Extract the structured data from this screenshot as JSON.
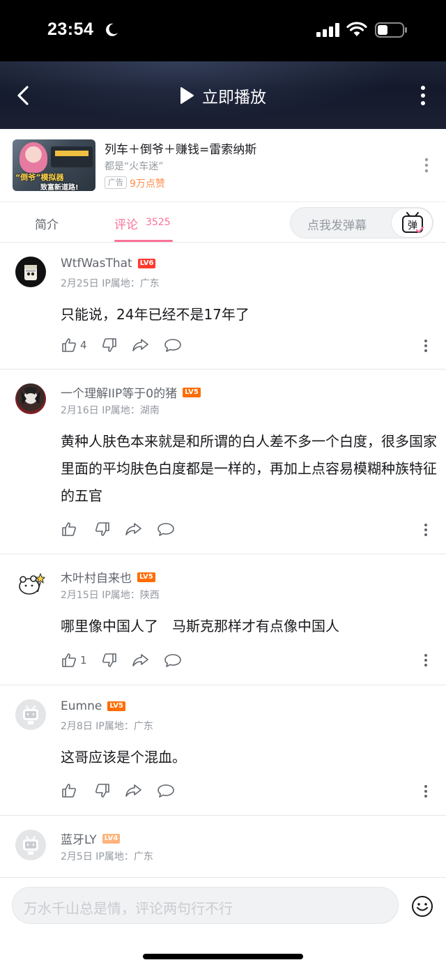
{
  "status_bar": {
    "time": "23:54"
  },
  "video_header": {
    "play_label": "立即播放"
  },
  "ad": {
    "title": "列车＋倒爷＋赚钱=雷索纳斯",
    "subtitle": "都是“火车迷”",
    "tag": "广告",
    "likes": "9万点赞",
    "thumb_text_1": "“倒爷”模拟器",
    "thumb_text_2": "致富新道路!"
  },
  "tabs": {
    "intro": "简介",
    "comments": "评论",
    "comment_count": "3525",
    "danmaku_placeholder": "点我发弹幕",
    "danmaku_icon_char": "弹"
  },
  "comments": [
    {
      "user": "WtfWasThat",
      "level": "LV6",
      "date": "2月25日",
      "ip": "IP属地：广东",
      "text": "只能说，24年已经不是17年了",
      "likes": "4"
    },
    {
      "user": "一个理解IIP等于0的猪",
      "level": "LV5",
      "date": "2月16日",
      "ip": "IP属地：湖南",
      "text": "黄种人肤色本来就是和所谓的白人差不多一个白度，很多国家里面的平均肤色白度都是一样的，再加上点容易模糊种族特征的五官",
      "likes": ""
    },
    {
      "user": "木叶村自来也",
      "level": "LV5",
      "date": "2月15日",
      "ip": "IP属地：陕西",
      "text": "哪里像中国人了　马斯克那样才有点像中国人",
      "likes": "1"
    },
    {
      "user": "Eumne",
      "level": "LV5",
      "date": "2月8日",
      "ip": "IP属地：广东",
      "text": "这哥应该是个混血。",
      "likes": ""
    },
    {
      "user": "蓝牙LY",
      "level": "LV4",
      "date": "2月5日",
      "ip": "IP属地：广东",
      "text": "",
      "likes": ""
    }
  ],
  "input": {
    "placeholder": "万水千山总是情，评论两句行不行"
  },
  "colors": {
    "accent": "#fb7299",
    "lv6": "#ff3b2f",
    "lv5": "#ff6c00",
    "lv4": "#ffb37c",
    "ad_likes": "#ff8d4b"
  }
}
